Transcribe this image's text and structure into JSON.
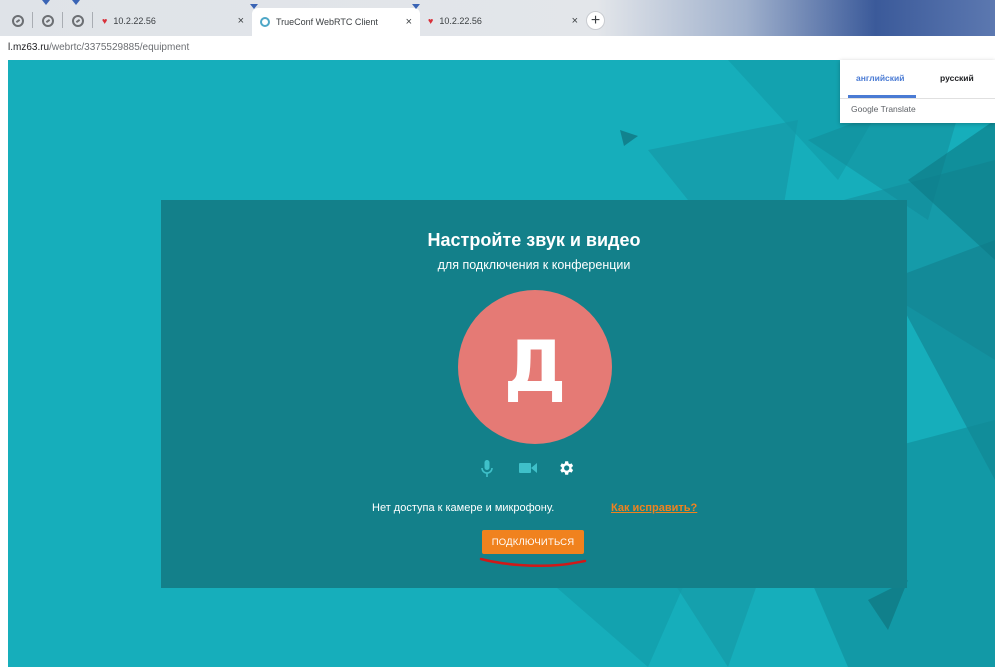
{
  "browser": {
    "tabs": [
      {
        "label": "10.2.22.56",
        "close": "×"
      },
      {
        "label": "TrueConf WebRTC Client",
        "close": "×"
      },
      {
        "label": "10.2.22.56",
        "close": "×"
      }
    ],
    "new_tab": "+",
    "url_host": "l.mz63.ru",
    "url_path": "/webrtc/3375529885/equipment"
  },
  "translate": {
    "lang_en": "английский",
    "lang_ru": "русский",
    "brand": "Google Translate"
  },
  "card": {
    "title": "Настройте звук и видео",
    "subtitle": "для подключения к конференции",
    "avatar_letter": "Д",
    "warning": "Нет доступа к камере и микрофону.",
    "fix_link": "Как исправить?",
    "connect_button": "подключиться"
  },
  "colors": {
    "background": "#16aebb",
    "card": "#13808a",
    "avatar": "#e57a75",
    "accent": "#f0821e"
  },
  "icons": [
    "mic-icon",
    "camera-icon",
    "gear-icon",
    "globe-icon",
    "heart-icon"
  ]
}
